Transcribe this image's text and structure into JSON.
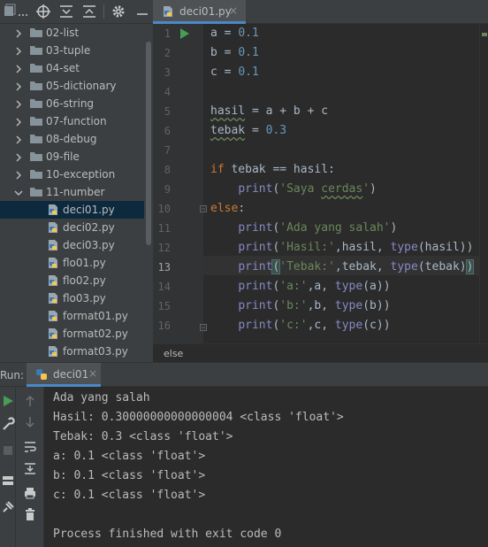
{
  "project": {
    "items": [
      {
        "label": "02-list",
        "kind": "folder"
      },
      {
        "label": "03-tuple",
        "kind": "folder"
      },
      {
        "label": "04-set",
        "kind": "folder"
      },
      {
        "label": "05-dictionary",
        "kind": "folder"
      },
      {
        "label": "06-string",
        "kind": "folder"
      },
      {
        "label": "07-function",
        "kind": "folder"
      },
      {
        "label": "08-debug",
        "kind": "folder"
      },
      {
        "label": "09-file",
        "kind": "folder"
      },
      {
        "label": "10-exception",
        "kind": "folder"
      },
      {
        "label": "11-number",
        "kind": "folder-open"
      },
      {
        "label": "deci01.py",
        "kind": "file",
        "selected": true
      },
      {
        "label": "deci02.py",
        "kind": "file"
      },
      {
        "label": "deci03.py",
        "kind": "file"
      },
      {
        "label": "flo01.py",
        "kind": "file"
      },
      {
        "label": "flo02.py",
        "kind": "file"
      },
      {
        "label": "flo03.py",
        "kind": "file"
      },
      {
        "label": "format01.py",
        "kind": "file"
      },
      {
        "label": "format02.py",
        "kind": "file"
      },
      {
        "label": "format03.py",
        "kind": "file"
      }
    ]
  },
  "editor": {
    "tab": {
      "label": "deci01.py",
      "close": "×"
    },
    "current_line": 13,
    "line_numbers": [
      "1",
      "2",
      "3",
      "4",
      "5",
      "6",
      "7",
      "8",
      "9",
      "10",
      "11",
      "12",
      "13",
      "14",
      "15",
      "16"
    ],
    "breadcrumb": "else"
  },
  "run": {
    "label": "Run:",
    "tab": {
      "label": "deci01",
      "close": "×"
    },
    "output": [
      "Ada yang salah",
      "Hasil: 0.30000000000000004 <class 'float'>",
      "Tebak: 0.3 <class 'float'>",
      "a: 0.1 <class 'float'>",
      "b: 0.1 <class 'float'>",
      "c: 0.1 <class 'float'>",
      "",
      "Process finished with exit code 0"
    ]
  },
  "colors": {
    "keyword": "#cc7832",
    "builtin": "#8888c6",
    "string": "#6a8759",
    "number": "#6897bb",
    "selection": "#0d293e",
    "accent": "#4a88c7",
    "run_green": "#499c54"
  },
  "icons": {
    "toolbar": [
      "project-menu-icon",
      "locate-icon",
      "expand-all-icon",
      "collapse-all-icon",
      "gear-icon",
      "hide-icon"
    ],
    "run_side": [
      "rerun-icon",
      "wrench-icon",
      "stop-icon",
      "layout-icon",
      "pin-icon"
    ],
    "run_side2": [
      "up-arrow-icon",
      "down-arrow-icon",
      "soft-wrap-icon",
      "scroll-to-end-icon",
      "print-icon",
      "trash-icon"
    ]
  }
}
